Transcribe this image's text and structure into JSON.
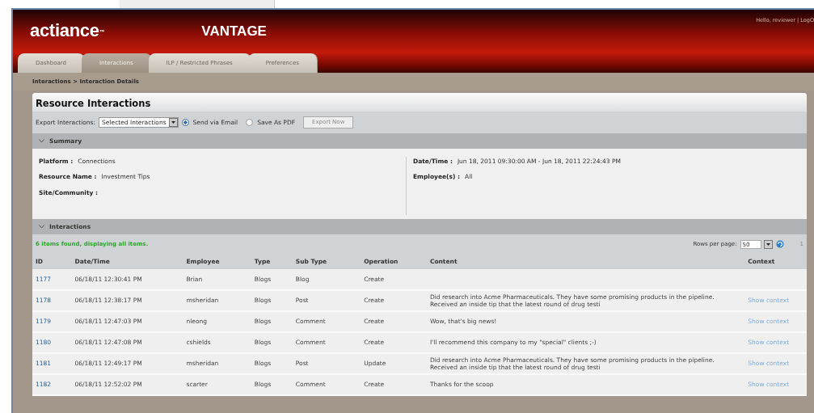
{
  "header": {
    "logo": "actiance",
    "logo_mark": "™",
    "product": "VANTAGE",
    "user_links": "Hello, reviewer | LogO"
  },
  "tabs": [
    {
      "label": "Dashboard",
      "selected": false
    },
    {
      "label": "Interactions",
      "selected": true
    },
    {
      "label": "ILP / Restricted Phrases",
      "selected": false
    },
    {
      "label": "Preferences",
      "selected": false
    }
  ],
  "breadcrumb": "Interactions > Interaction Details",
  "panel": {
    "title": "Resource Interactions",
    "export": {
      "label": "Export Interactions:",
      "dropdown_value": "Selected Interactions",
      "options": [
        {
          "label": "Send via Email",
          "selected": true
        },
        {
          "label": "Save As PDF",
          "selected": false
        }
      ],
      "button": {
        "label": "Export Now",
        "disabled": true
      }
    },
    "summary": {
      "title": "Summary",
      "expanded": true,
      "left": [
        {
          "label": "Platform :",
          "value": "Connections"
        },
        {
          "label": "Resource Name :",
          "value": "Investment Tips"
        },
        {
          "label": "Site/Community :"
        }
      ],
      "right": [
        {
          "label": "Date/Time :",
          "value": "Jun 18, 2011 09:30:00 AM - Jun 18, 2011 22:24:43 PM"
        },
        {
          "label": "Employee(s) :",
          "value": "All"
        }
      ]
    },
    "interactions": {
      "title": "Interactions",
      "expanded": true,
      "status": "6 items found, displaying all items.",
      "rows_per_page_label": "Rows per page:",
      "rows_per_page": "50",
      "page": "1",
      "columns": [
        "ID",
        "Date/Time",
        "Employee",
        "Type",
        "Sub Type",
        "Operation",
        "Content",
        "Context"
      ],
      "rows": [
        {
          "id": "1177",
          "datetime": "06/18/11 12:30:41 PM",
          "employee": "Brian",
          "type": "Blogs",
          "sub_type": "Blog",
          "operation": "Create"
        },
        {
          "id": "1178",
          "datetime": "06/18/11 12:38:17 PM",
          "employee": "msheridan",
          "type": "Blogs",
          "sub_type": "Post",
          "operation": "Create",
          "content": "Did research into Acme Pharmaceuticals. They have some promising products in the pipeline. Received an inside tip that the latest round of drug testi",
          "context": "Show context"
        },
        {
          "id": "1179",
          "datetime": "06/18/11 12:47:03 PM",
          "employee": "nleong",
          "type": "Blogs",
          "sub_type": "Comment",
          "operation": "Create",
          "content": "Wow, that's big news!",
          "context": "Show context"
        },
        {
          "id": "1180",
          "datetime": "06/18/11 12:47:08 PM",
          "employee": "cshields",
          "type": "Blogs",
          "sub_type": "Comment",
          "operation": "Create",
          "content": "I'll recommend this company to my \"special\" clients ;-)",
          "context": "Show context"
        },
        {
          "id": "1181",
          "datetime": "06/18/11 12:49:17 PM",
          "employee": "msheridan",
          "type": "Blogs",
          "sub_type": "Post",
          "operation": "Update",
          "content": "Did research into Acme Pharmaceuticals. They have some promising products in the pipeline. Received an inside tip that the latest round of drug testi",
          "context": "Show context"
        },
        {
          "id": "1182",
          "datetime": "06/18/11 12:52:02 PM",
          "employee": "scarter",
          "type": "Blogs",
          "sub_type": "Comment",
          "operation": "Create",
          "content": "Thanks for the scoop",
          "context": "Show context"
        }
      ]
    }
  }
}
